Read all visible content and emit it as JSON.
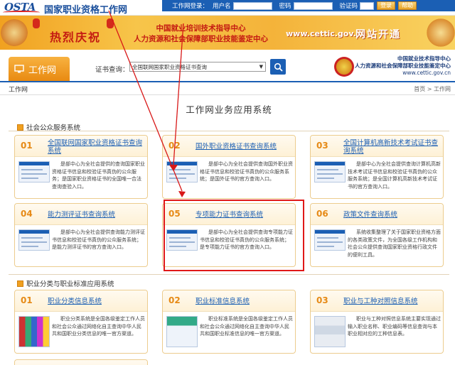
{
  "header": {
    "logo": "OSTA",
    "site_title": "国家职业资格工作网",
    "login_label": "工作网登录：",
    "username_label": "用户名",
    "password_label": "密码",
    "captcha_label": "验证码",
    "login_button": "登录",
    "help_button": "帮助"
  },
  "banner": {
    "celebrate": "热烈庆祝",
    "org_line1": "中国就业培训技术指导中心",
    "org_line2": "人力资源和社会保障部职业技能鉴定中心",
    "url": "www.cettic.gov.cn",
    "opening": "网站开通"
  },
  "nav": {
    "tab_label": "工作网",
    "cert_search_label": "证书查询：",
    "cert_select_value": "全国联网国家职业资格证书查询",
    "partner_line1": "中国就业技术指导中心",
    "partner_line2": "人力资源和社会保障部职业技能鉴定中心",
    "partner_url": "www.cettic.gov.cn"
  },
  "breadcrumb": {
    "left": "工作网",
    "right": "首页 > 工作网"
  },
  "main": {
    "title": "工作网业务应用系统",
    "section1": "社会公众服务系统",
    "section2": "职业分类与职业标准应用系统",
    "cards": [
      {
        "num": "01",
        "title": "全国联网国家职业资格证书查询系统",
        "desc": "是部中心为全社会提供的查询国家职业资格证书信息和校验证书真伪的公众服务；是国家职业资格证书的全国唯一合法查询查验入口。"
      },
      {
        "num": "02",
        "title": "国外职业资格证书查询系统",
        "desc": "是部中心为全社会提供查询国外职业资格证书信息和校验证书真伪的公众服务系统；是国外证书的官方查询入口。"
      },
      {
        "num": "03",
        "title": "全国计算机高新技术考试证书查询系统",
        "desc": "是部中心为全社会提供查询计算机高新技术考试证书信息和校验证书真伪的公众服务系统；是全国计算机高新技术考试证书的官方查询入口。"
      },
      {
        "num": "04",
        "title": "能力测评证书查询系统",
        "desc": "是部中心为全社会提供查询能力测评证书信息和校验证书真伪的公众服务系统；是能力测评证书的官方查询入口。"
      },
      {
        "num": "05",
        "title": "专项能力证书查询系统",
        "desc": "是部中心为全社会提供查询专项能力证书信息和校验证书真伪的公众服务系统；是专项能力证书的官方查询入口。"
      },
      {
        "num": "06",
        "title": "政策文件查询系统",
        "desc": "系统收集整理了关于国家职业资格方面的各类政策文件，为全国各级工作机构和社会公众提供查询国家职业资格行政文件的便利工具。"
      },
      {
        "num": "01",
        "title": "职业分类信息系统",
        "desc": "职业分类系统是全国各级鉴定工作人员和社会公众通过网络化自主查询中华人民共和国职业分类信息的唯一官方渠道。"
      },
      {
        "num": "02",
        "title": "职业标准信息系统",
        "desc": "职业标准系统是全国各级鉴定工作人员和社会公众通过网络化自主查询中华人民共和国职业标准信息的唯一官方渠道。"
      },
      {
        "num": "03",
        "title": "职业与工种对照信息系统",
        "desc": "职业与工种对照信息系统主要实现通过输入职业名称、职业编码等信息查询与本职业相对应的工种信息表。"
      }
    ]
  },
  "colors": {
    "brand_blue": "#1b5fb4",
    "accent_orange": "#e68a16",
    "highlight_red": "#e01818"
  }
}
